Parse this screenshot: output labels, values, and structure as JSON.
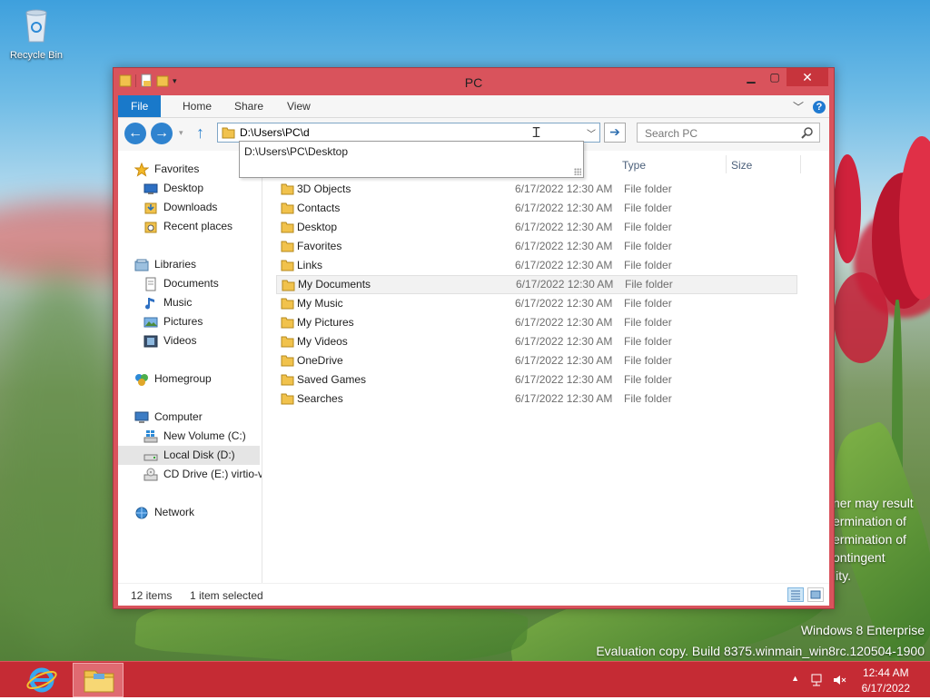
{
  "desktop": {
    "recycle_bin_label": "Recycle Bin",
    "watermark_edition": "Windows 8 Enterprise",
    "watermark_build": "Evaluation copy. Build 8375.winmain_win8rc.120504-1900",
    "legal_lines": [
      "ner may result",
      "ermination of",
      "ermination of",
      "ontingent",
      "lity."
    ]
  },
  "window": {
    "title": "PC",
    "ribbon_tabs": [
      "File",
      "Home",
      "Share",
      "View"
    ],
    "address_value": "D:\\Users\\PC\\d",
    "search_placeholder": "Search PC",
    "suggestion": "D:\\Users\\PC\\Desktop",
    "nav_groups": [
      {
        "label": "Favorites",
        "icon": "star-icon",
        "items": [
          {
            "label": "Desktop",
            "icon": "desktop-icon"
          },
          {
            "label": "Downloads",
            "icon": "downloads-icon"
          },
          {
            "label": "Recent places",
            "icon": "recent-places-icon"
          }
        ]
      },
      {
        "label": "Libraries",
        "icon": "libraries-icon",
        "items": [
          {
            "label": "Documents",
            "icon": "documents-icon"
          },
          {
            "label": "Music",
            "icon": "music-icon"
          },
          {
            "label": "Pictures",
            "icon": "pictures-icon"
          },
          {
            "label": "Videos",
            "icon": "videos-icon"
          }
        ]
      },
      {
        "label": "Homegroup",
        "icon": "homegroup-icon",
        "items": []
      },
      {
        "label": "Computer",
        "icon": "computer-icon",
        "items": [
          {
            "label": "New Volume (C:)",
            "icon": "windows-drive-icon"
          },
          {
            "label": "Local Disk (D:)",
            "icon": "drive-icon",
            "selected": true
          },
          {
            "label": "CD Drive (E:) virtio-v",
            "icon": "cd-drive-icon"
          }
        ]
      },
      {
        "label": "Network",
        "icon": "network-icon",
        "items": []
      }
    ],
    "columns": {
      "type": "Type",
      "size": "Size"
    },
    "files": [
      {
        "name": "3D Objects",
        "date": "6/17/2022 12:30 AM",
        "type": "File folder"
      },
      {
        "name": "Contacts",
        "date": "6/17/2022 12:30 AM",
        "type": "File folder"
      },
      {
        "name": "Desktop",
        "date": "6/17/2022 12:30 AM",
        "type": "File folder"
      },
      {
        "name": "Favorites",
        "date": "6/17/2022 12:30 AM",
        "type": "File folder"
      },
      {
        "name": "Links",
        "date": "6/17/2022 12:30 AM",
        "type": "File folder"
      },
      {
        "name": "My Documents",
        "date": "6/17/2022 12:30 AM",
        "type": "File folder",
        "selected": true
      },
      {
        "name": "My Music",
        "date": "6/17/2022 12:30 AM",
        "type": "File folder"
      },
      {
        "name": "My Pictures",
        "date": "6/17/2022 12:30 AM",
        "type": "File folder"
      },
      {
        "name": "My Videos",
        "date": "6/17/2022 12:30 AM",
        "type": "File folder"
      },
      {
        "name": "OneDrive",
        "date": "6/17/2022 12:30 AM",
        "type": "File folder"
      },
      {
        "name": "Saved Games",
        "date": "6/17/2022 12:30 AM",
        "type": "File folder"
      },
      {
        "name": "Searches",
        "date": "6/17/2022 12:30 AM",
        "type": "File folder"
      }
    ],
    "status_items": "12 items",
    "status_selected": "1 item selected"
  },
  "taskbar": {
    "time": "12:44 AM",
    "date": "6/17/2022"
  },
  "colors": {
    "accent": "#1979ca",
    "window_frame": "#d9535c",
    "taskbar": "#c52b34"
  }
}
